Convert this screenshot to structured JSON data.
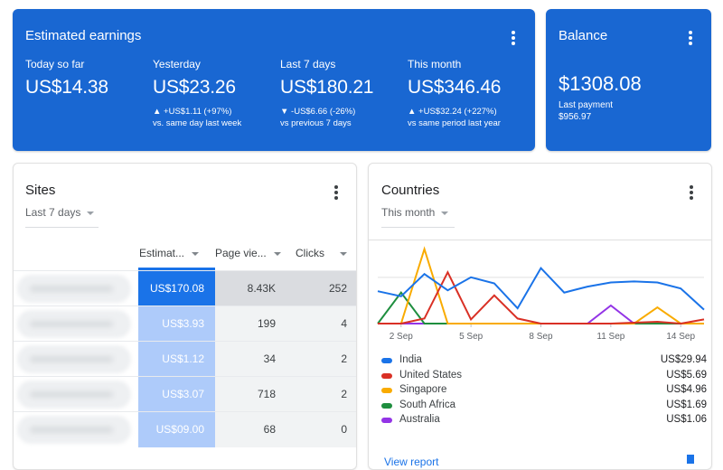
{
  "earnings": {
    "title": "Estimated earnings",
    "metrics": [
      {
        "label": "Today so far",
        "value": "US$14.38",
        "delta": "",
        "compare": ""
      },
      {
        "label": "Yesterday",
        "value": "US$23.26",
        "delta": "▲ +US$1.11 (+97%)",
        "compare": "vs. same day last week"
      },
      {
        "label": "Last 7 days",
        "value": "US$180.21",
        "delta": "▼ -US$6.66 (-26%)",
        "compare": "vs previous 7 days"
      },
      {
        "label": "This month",
        "value": "US$346.46",
        "delta": "▲ +US$32.24 (+227%)",
        "compare": "vs same period last year"
      }
    ]
  },
  "balance": {
    "title": "Balance",
    "value": "$1308.08",
    "last_payment_label": "Last payment",
    "last_payment_value": "$956.97"
  },
  "sites": {
    "title": "Sites",
    "period": "Last 7 days",
    "columns": [
      "Estimat...",
      "Page vie...",
      "Clicks"
    ],
    "rows": [
      {
        "site": "",
        "earnings": "US$170.08",
        "page_views": "8.43K",
        "clicks": "252"
      },
      {
        "site": "",
        "earnings": "US$3.93",
        "page_views": "199",
        "clicks": "4"
      },
      {
        "site": "",
        "earnings": "US$1.12",
        "page_views": "34",
        "clicks": "2"
      },
      {
        "site": "",
        "earnings": "US$3.07",
        "page_views": "718",
        "clicks": "2"
      },
      {
        "site": "",
        "earnings": "US$09.00",
        "page_views": "68",
        "clicks": "0"
      }
    ]
  },
  "countries": {
    "title": "Countries",
    "period": "This month",
    "legend": [
      {
        "name": "India",
        "amount": "US$29.94",
        "color": "#1a73e8"
      },
      {
        "name": "United States",
        "amount": "US$5.69",
        "color": "#d93025"
      },
      {
        "name": "Singapore",
        "amount": "US$4.96",
        "color": "#f9ab00"
      },
      {
        "name": "South Africa",
        "amount": "US$1.69",
        "color": "#1e8e3e"
      },
      {
        "name": "Australia",
        "amount": "US$1.06",
        "color": "#9334e6"
      }
    ],
    "view_report": "View report"
  },
  "chart_data": {
    "type": "line",
    "title": "",
    "xlabel": "",
    "ylabel": "",
    "x": [
      "1 Sep",
      "2 Sep",
      "3 Sep",
      "4 Sep",
      "5 Sep",
      "6 Sep",
      "7 Sep",
      "8 Sep",
      "9 Sep",
      "10 Sep",
      "11 Sep",
      "12 Sep",
      "13 Sep",
      "14 Sep",
      "15 Sep"
    ],
    "x_tick_labels": [
      "2 Sep",
      "5 Sep",
      "8 Sep",
      "11 Sep",
      "14 Sep"
    ],
    "x_tick_index": [
      1,
      4,
      7,
      10,
      13
    ],
    "ylim": [
      0,
      1.7
    ],
    "y_gridline": 1.0,
    "grid": true,
    "series": [
      {
        "name": "India",
        "color": "#1a73e8",
        "values": [
          0.7,
          0.59,
          1.07,
          0.72,
          1.0,
          0.87,
          0.33,
          1.2,
          0.67,
          0.8,
          0.89,
          0.91,
          0.89,
          0.76,
          0.3
        ]
      },
      {
        "name": "United States",
        "color": "#d93025",
        "values": [
          0,
          0,
          0.11,
          1.11,
          0.09,
          0.61,
          0.11,
          0,
          0,
          0,
          0,
          0.02,
          0.04,
          0,
          0.09
        ]
      },
      {
        "name": "Singapore",
        "color": "#f9ab00",
        "values": [
          0,
          0,
          1.61,
          0,
          0,
          0,
          0,
          0,
          0,
          0,
          0,
          0,
          0.35,
          0,
          0
        ]
      },
      {
        "name": "South Africa",
        "color": "#1e8e3e",
        "values": [
          0,
          0.67,
          0,
          0,
          0,
          0,
          0,
          0,
          0,
          0,
          0,
          0,
          0,
          0,
          0
        ]
      },
      {
        "name": "Australia",
        "color": "#9334e6",
        "values": [
          0,
          0,
          0,
          0,
          0,
          0,
          0,
          0,
          0,
          0,
          0.39,
          0,
          0,
          0,
          0
        ]
      }
    ]
  }
}
